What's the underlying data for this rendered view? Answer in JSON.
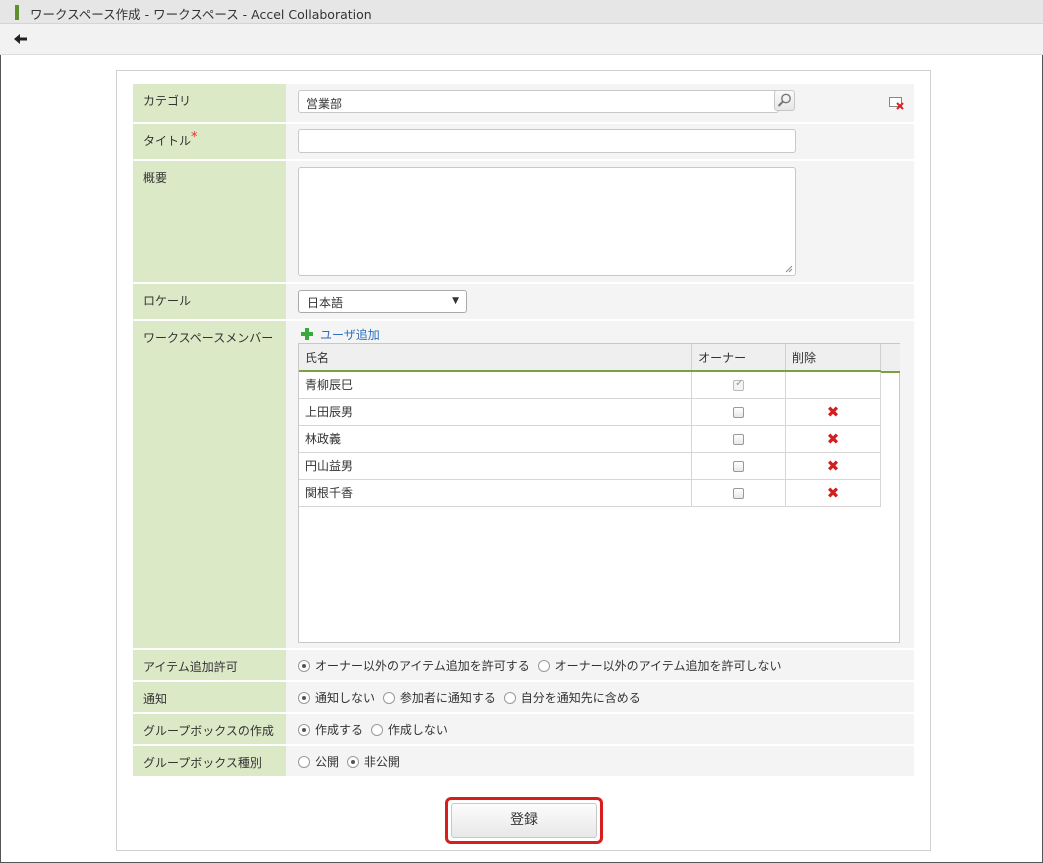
{
  "window": {
    "title": "ワークスペース作成 - ワークスペース - Accel Collaboration"
  },
  "icons": {
    "back": "back-arrow-icon",
    "search": "magnifier-icon",
    "clear": "clear-icon",
    "add": "plus-icon",
    "delete": "red-x-icon"
  },
  "form": {
    "category": {
      "label": "カテゴリ",
      "value": "営業部"
    },
    "title": {
      "label": "タイトル",
      "required_mark": "*",
      "value": ""
    },
    "summary": {
      "label": "概要",
      "value": ""
    },
    "locale": {
      "label": "ロケール",
      "selected": "日本語"
    },
    "members": {
      "label": "ワークスペースメンバー",
      "add_link": "ユーザ追加",
      "columns": [
        "氏名",
        "オーナー",
        "削除"
      ],
      "rows": [
        {
          "name": "青柳辰巳",
          "owner": true,
          "owner_disabled": true,
          "deletable": false
        },
        {
          "name": "上田辰男",
          "owner": false,
          "owner_disabled": false,
          "deletable": true
        },
        {
          "name": "林政義",
          "owner": false,
          "owner_disabled": false,
          "deletable": true
        },
        {
          "name": "円山益男",
          "owner": false,
          "owner_disabled": false,
          "deletable": true
        },
        {
          "name": "関根千香",
          "owner": false,
          "owner_disabled": false,
          "deletable": true
        }
      ]
    },
    "item_permission": {
      "label": "アイテム追加許可",
      "options": [
        "オーナー以外のアイテム追加を許可する",
        "オーナー以外のアイテム追加を許可しない"
      ],
      "selected_index": 0
    },
    "notification": {
      "label": "通知",
      "options": [
        "通知しない",
        "参加者に通知する",
        "自分を通知先に含める"
      ],
      "selected_index": 0
    },
    "groupbox_create": {
      "label": "グループボックスの作成",
      "options": [
        "作成する",
        "作成しない"
      ],
      "selected_index": 0
    },
    "groupbox_type": {
      "label": "グループボックス種別",
      "options": [
        "公開",
        "非公開"
      ],
      "selected_index": 1
    },
    "submit_label": "登録"
  },
  "colors": {
    "label_bg": "#dce9c7",
    "accent_green": "#7aa242",
    "highlight_red": "#d91c1c",
    "link_blue": "#2a6fbd"
  }
}
